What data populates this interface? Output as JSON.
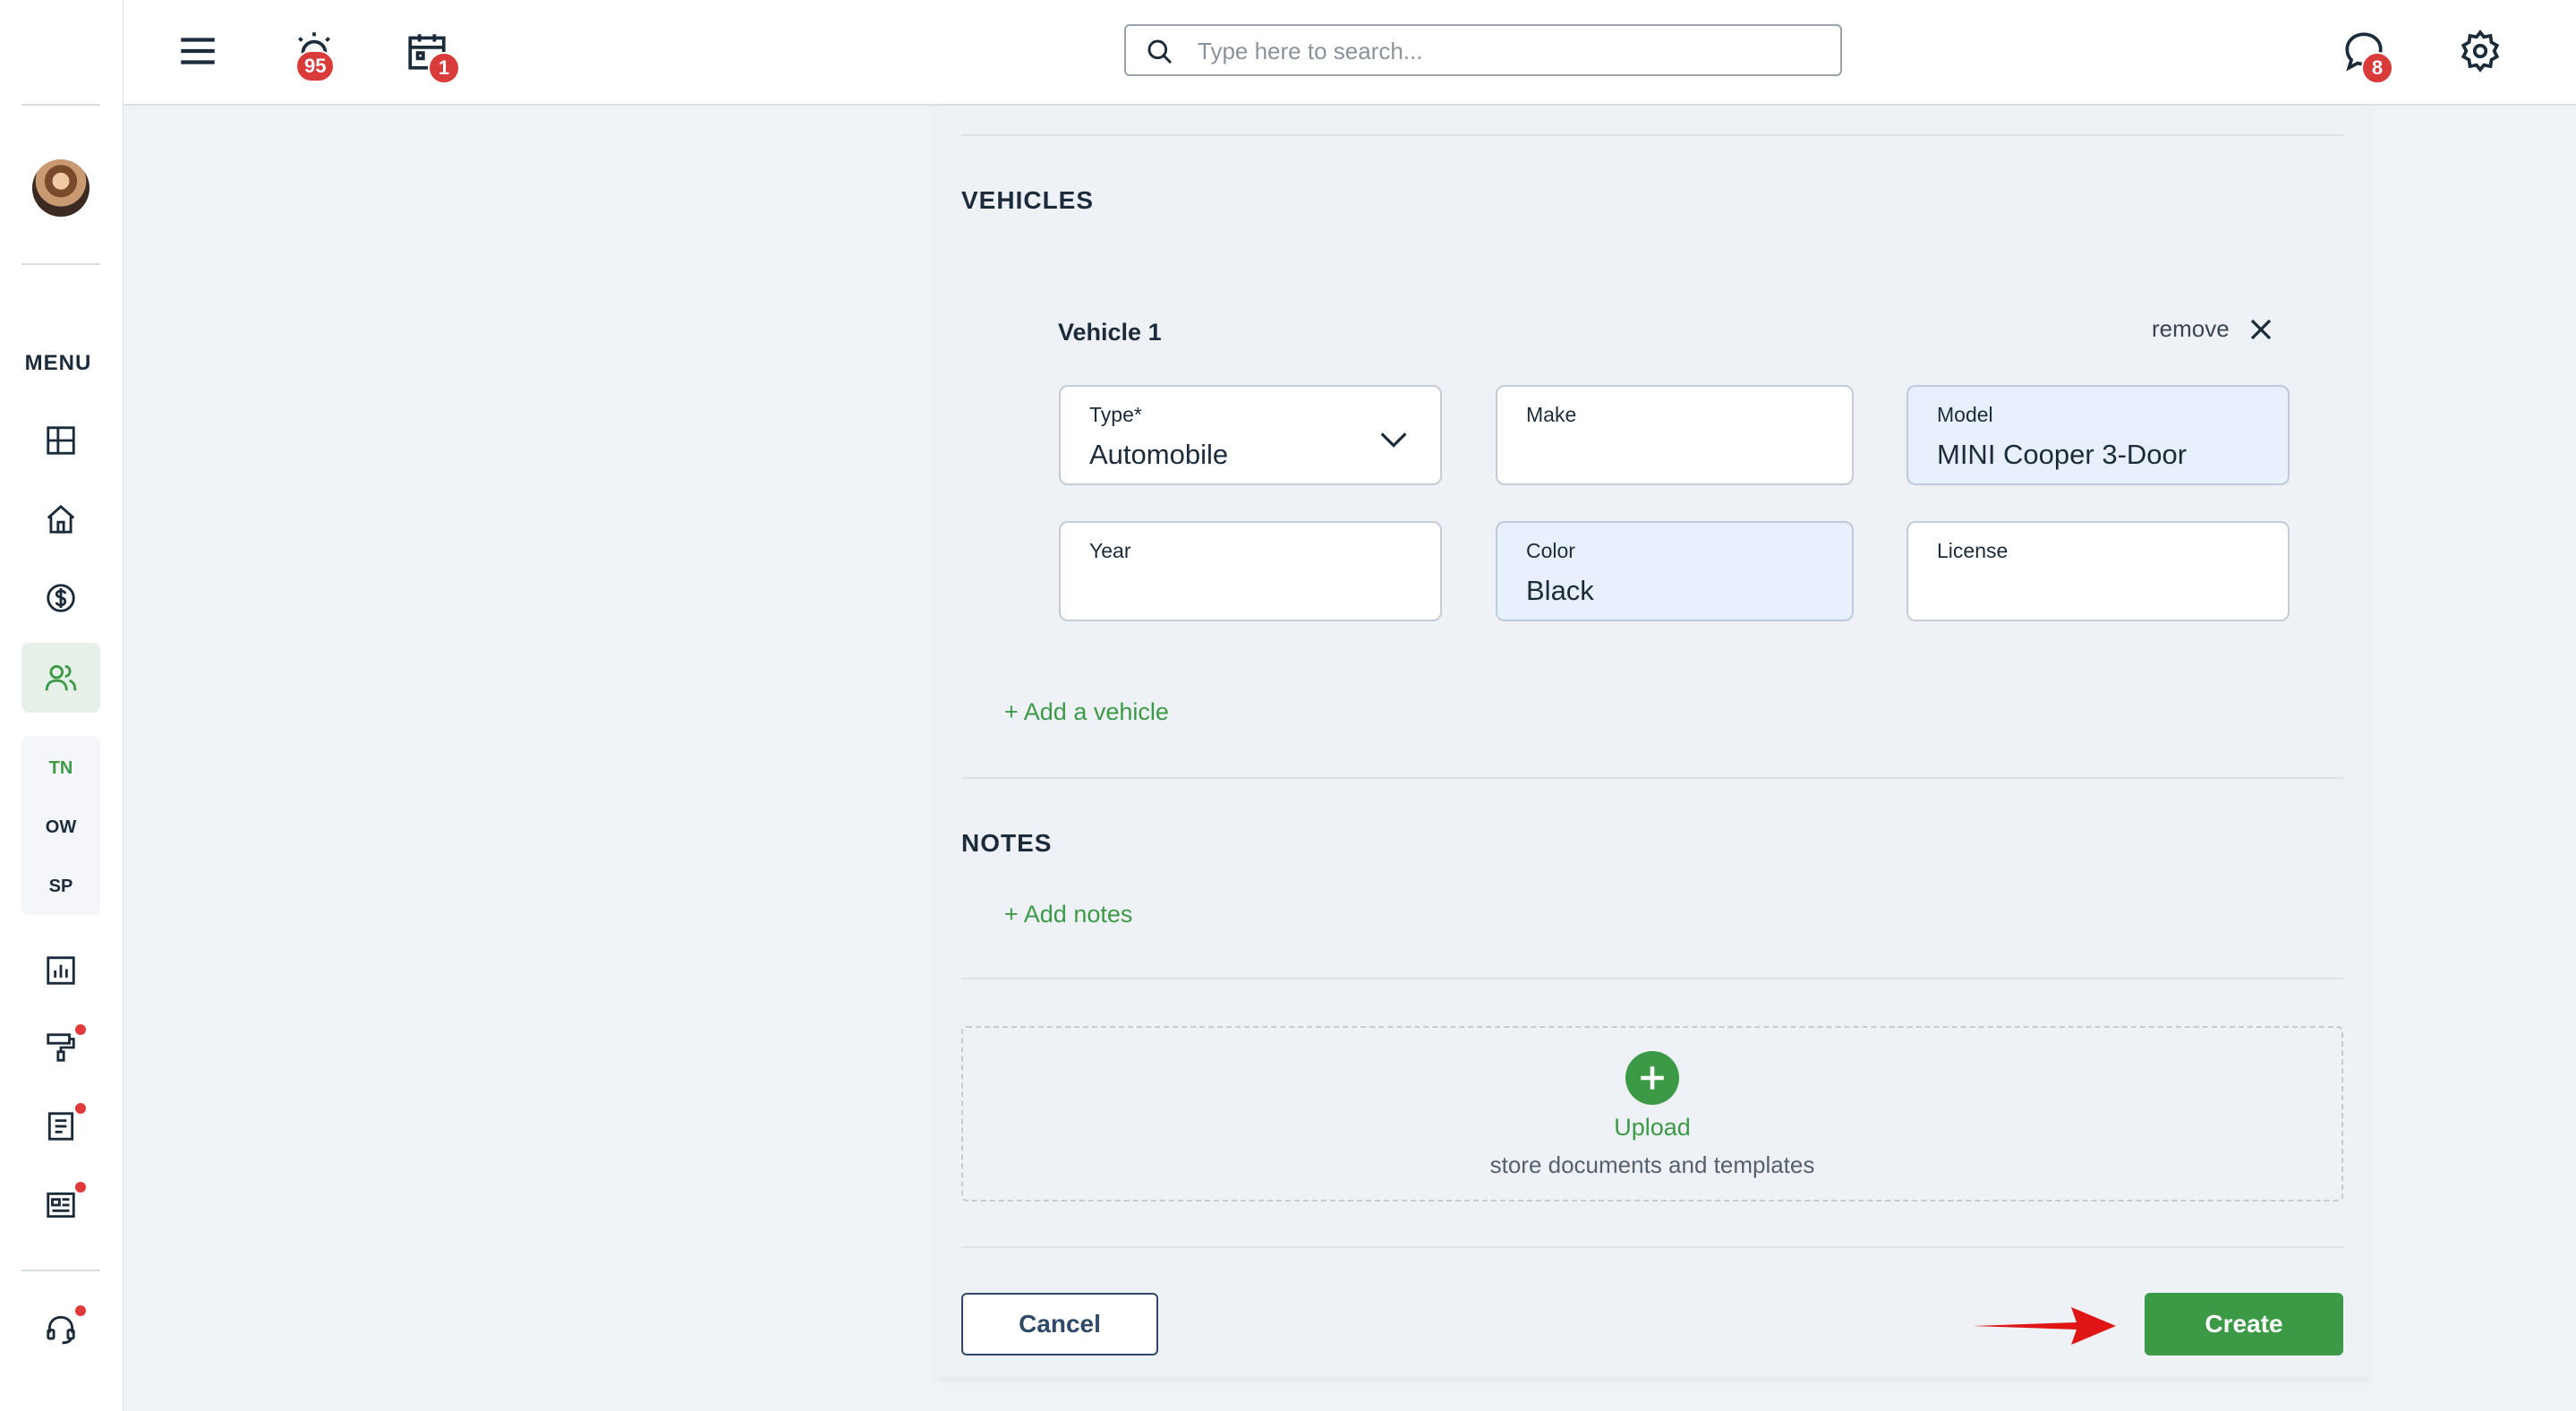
{
  "topbar": {
    "alarm_badge": "95",
    "calendar_badge": "1",
    "chat_badge": "8",
    "search_placeholder": "Type here to search..."
  },
  "sidebar": {
    "menu_label": "MENU",
    "sub_items": [
      "TN",
      "OW",
      "SP"
    ],
    "colors": {
      "active_bg": "#e6f1ea",
      "active_icon": "#3c9a47",
      "notification_dot": "#e03a3a"
    }
  },
  "vehicles": {
    "section_title": "VEHICLES",
    "vehicle_title": "Vehicle 1",
    "remove_label": "remove",
    "fields": {
      "type": {
        "label": "Type*",
        "value": "Automobile"
      },
      "make": {
        "label": "Make",
        "value": ""
      },
      "model": {
        "label": "Model",
        "value": "MINI Cooper 3-Door"
      },
      "year": {
        "label": "Year",
        "value": ""
      },
      "color": {
        "label": "Color",
        "value": "Black"
      },
      "license": {
        "label": "License",
        "value": ""
      }
    },
    "add_vehicle_link": "+ Add a vehicle"
  },
  "notes": {
    "section_title": "NOTES",
    "add_notes_link": "+ Add notes"
  },
  "upload": {
    "title": "Upload",
    "subtitle": "store documents and templates"
  },
  "actions": {
    "cancel_label": "Cancel",
    "create_label": "Create"
  },
  "colors": {
    "accent_green": "#3c9a47",
    "badge_red": "#d93a3a",
    "annotation_arrow": "#e01515"
  }
}
